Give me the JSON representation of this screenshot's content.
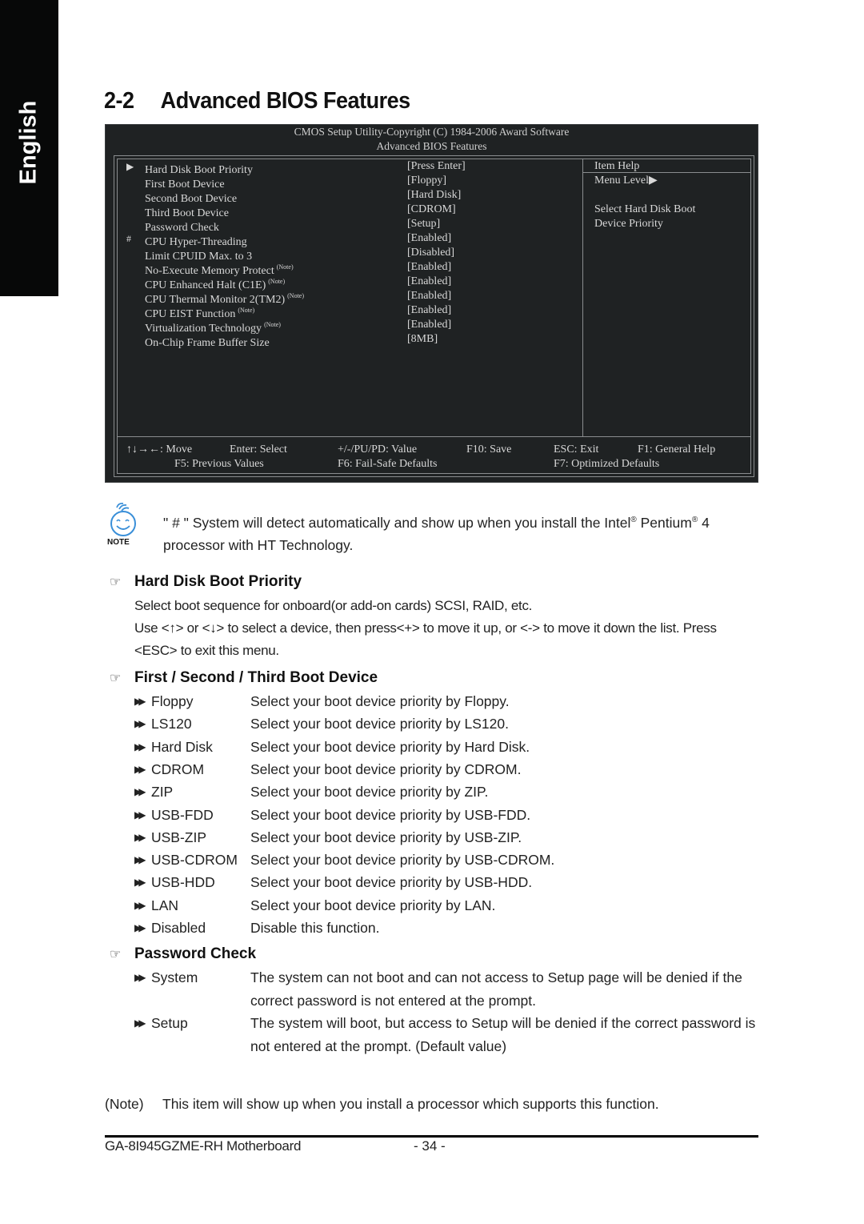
{
  "side_tab": {
    "label": "English"
  },
  "title": {
    "number": "2-2",
    "text": "Advanced BIOS Features"
  },
  "bios": {
    "header_line1": "CMOS Setup Utility-Copyright (C) 1984-2006 Award Software",
    "header_line2": "Advanced BIOS Features",
    "items": [
      {
        "marker": "▶",
        "name": "Hard Disk Boot Priority",
        "note": "",
        "value": "[Press Enter]"
      },
      {
        "marker": "",
        "name": "First Boot Device",
        "note": "",
        "value": "[Floppy]"
      },
      {
        "marker": "",
        "name": "Second Boot Device",
        "note": "",
        "value": "[Hard Disk]"
      },
      {
        "marker": "",
        "name": "Third Boot Device",
        "note": "",
        "value": "[CDROM]"
      },
      {
        "marker": "",
        "name": "Password Check",
        "note": "",
        "value": "[Setup]"
      },
      {
        "marker": "#",
        "name": "CPU Hyper-Threading",
        "note": "",
        "value": "[Enabled]"
      },
      {
        "marker": "",
        "name": "Limit CPUID Max. to 3",
        "note": "",
        "value": "[Disabled]"
      },
      {
        "marker": "",
        "name": "No-Execute Memory Protect",
        "note": "(Note)",
        "value": "[Enabled]"
      },
      {
        "marker": "",
        "name": "CPU Enhanced Halt (C1E)",
        "note": "(Note)",
        "value": "[Enabled]"
      },
      {
        "marker": "",
        "name": "CPU Thermal Monitor 2(TM2)",
        "note": "(Note)",
        "value": "[Enabled]"
      },
      {
        "marker": "",
        "name": "CPU EIST Function",
        "note": "(Note)",
        "value": "[Enabled]"
      },
      {
        "marker": "",
        "name": "Virtualization Technology",
        "note": "(Note)",
        "value": "[Enabled]"
      },
      {
        "marker": "",
        "name": "On-Chip Frame Buffer Size",
        "note": "",
        "value": "[8MB]"
      }
    ],
    "help": {
      "title": "Item Help",
      "menu_level": "Menu Level▶",
      "line1": "Select Hard Disk Boot",
      "line2": "Device Priority"
    },
    "keys_row1": [
      "↑↓→←: Move",
      "Enter: Select",
      "+/-/PU/PD: Value",
      "F10: Save",
      "ESC: Exit",
      "F1: General Help"
    ],
    "keys_row2": [
      "F5: Previous Values",
      "F6: Fail-Safe Defaults",
      "F7: Optimized Defaults"
    ]
  },
  "note": {
    "icon_label": "NOTE",
    "line1_a": "\" # \" System will detect automatically and show up when you install the Intel",
    "reg": "®",
    "line1_b": " Pentium",
    "line1_c": " 4",
    "line2": "processor with HT Technology."
  },
  "sections": {
    "hdd_priority": {
      "heading": "Hard Disk Boot Priority",
      "p1": "Select boot sequence for onboard(or add-on cards) SCSI, RAID, etc.",
      "p2": "Use <↑> or <↓> to select a device, then press<+> to move it up, or <-> to move it down the list. Press",
      "p3": "<ESC> to exit this menu."
    },
    "boot_device": {
      "heading": "First / Second / Third Boot Device",
      "options": [
        {
          "name": "Floppy",
          "desc": "Select your boot device priority by Floppy."
        },
        {
          "name": "LS120",
          "desc": "Select your boot device priority by LS120."
        },
        {
          "name": "Hard Disk",
          "desc": "Select your boot device priority by Hard Disk."
        },
        {
          "name": "CDROM",
          "desc": "Select your boot device priority by CDROM."
        },
        {
          "name": "ZIP",
          "desc": "Select your boot device priority by ZIP."
        },
        {
          "name": "USB-FDD",
          "desc": "Select your boot device priority by USB-FDD."
        },
        {
          "name": "USB-ZIP",
          "desc": "Select your boot device priority by USB-ZIP."
        },
        {
          "name": "USB-CDROM",
          "desc": "Select your boot device priority by USB-CDROM."
        },
        {
          "name": "USB-HDD",
          "desc": "Select your boot device priority by USB-HDD."
        },
        {
          "name": "LAN",
          "desc": "Select your boot device priority by LAN."
        },
        {
          "name": "Disabled",
          "desc": "Disable this function."
        }
      ]
    },
    "password_check": {
      "heading": "Password Check",
      "options": [
        {
          "name": "System",
          "desc": "The system can not boot and can not access to Setup page will be denied if the correct password is not entered at the prompt."
        },
        {
          "name": "Setup",
          "desc": "The system will boot, but access to Setup will be denied if the correct password is not entered at the prompt. (Default value)"
        }
      ]
    }
  },
  "bullet_glyph": "▶▶",
  "hand_glyph": "☞",
  "footnote": {
    "label": "(Note)",
    "text": "This item will show up when you install a processor which supports this function."
  },
  "footer": {
    "model": "GA-8I945GZME-RH Motherboard",
    "page": "- 34 -"
  }
}
